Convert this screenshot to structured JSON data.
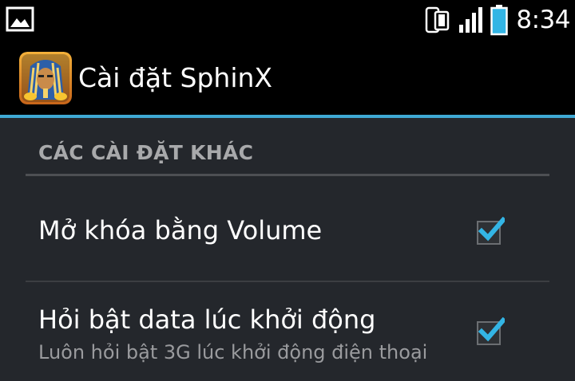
{
  "status_bar": {
    "left_icon": "image-notification-icon",
    "icons": [
      "phone-vibrate-icon",
      "signal-strength-icon",
      "battery-icon"
    ],
    "time": "8:34"
  },
  "action_bar": {
    "app_icon": "sphinx-app-icon",
    "title": "Cài đặt SphinX",
    "accent_color": "#3fa9d4"
  },
  "settings": {
    "section_header": "CÁC CÀI ĐẶT KHÁC",
    "items": [
      {
        "title": "Mở khóa bằng Volume",
        "summary": "",
        "checked": true
      },
      {
        "title": "Hỏi bật data lúc khởi động",
        "summary": "Luôn hỏi bật 3G lúc khởi động điện thoại",
        "checked": true
      }
    ],
    "check_color": "#33b5e5"
  }
}
